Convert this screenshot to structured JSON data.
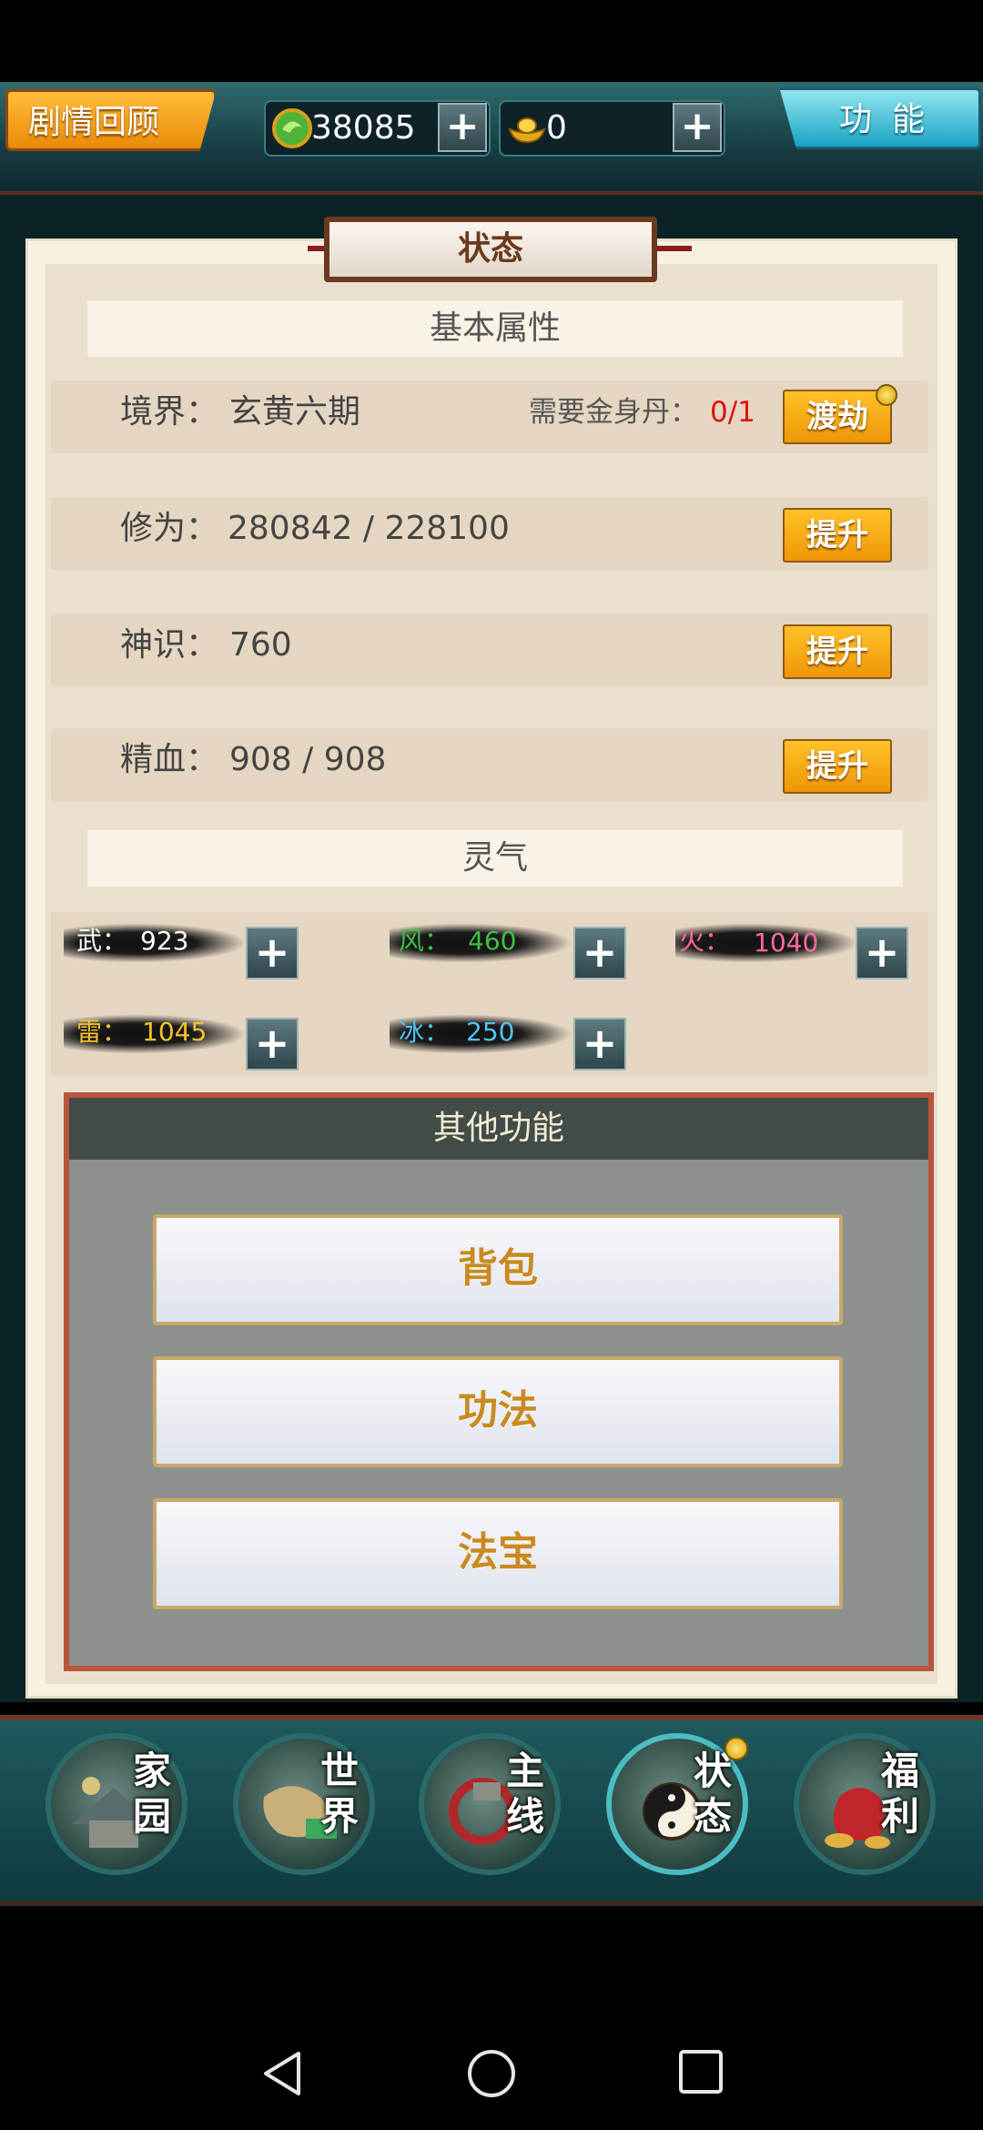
{
  "topbar": {
    "story_review": "剧情回顾",
    "jade_amount": "38085",
    "gold_amount": "0",
    "plus_label": "+",
    "function_label": "功能"
  },
  "panel": {
    "title": "状态",
    "basic_attributes_heading": "基本属性",
    "realm": {
      "label": "境界：",
      "value": "玄黄六期",
      "need_label": "需要金身丹：",
      "need_value": "0/1",
      "button": "渡劫"
    },
    "cultivation": {
      "label": "修为：",
      "value": "280842 / 228100",
      "button": "提升"
    },
    "divine_sense": {
      "label": "神识：",
      "value": "760",
      "button": "提升"
    },
    "essence_blood": {
      "label": "精血：",
      "value": "908 / 908",
      "button": "提升"
    },
    "spirit_heading": "灵气",
    "spirits": [
      {
        "label": "武：",
        "value": "923",
        "color": "#ffffff"
      },
      {
        "label": "风：",
        "value": "460",
        "color": "#3fbf3f"
      },
      {
        "label": "火：",
        "value": "1040",
        "color": "#ff6aa0"
      },
      {
        "label": "雷：",
        "value": "1045",
        "color": "#f2c22a"
      },
      {
        "label": "冰：",
        "value": "250",
        "color": "#4fc2f2"
      }
    ]
  },
  "other_functions": {
    "heading": "其他功能",
    "buttons": [
      "背包",
      "功法",
      "法宝"
    ]
  },
  "bottom_nav": {
    "items": [
      {
        "line1": "家",
        "line2": "园",
        "icon": "home-icon"
      },
      {
        "line1": "世",
        "line2": "界",
        "icon": "world-map-icon"
      },
      {
        "line1": "主",
        "line2": "线",
        "icon": "main-quest-icon"
      },
      {
        "line1": "状",
        "line2": "态",
        "icon": "status-taiji-icon"
      },
      {
        "line1": "福",
        "line2": "利",
        "icon": "welfare-bag-icon"
      }
    ]
  },
  "colors": {
    "accent_orange": "#f0a010",
    "accent_cyan": "#1aa3c3",
    "requirement_red": "#e01010"
  }
}
